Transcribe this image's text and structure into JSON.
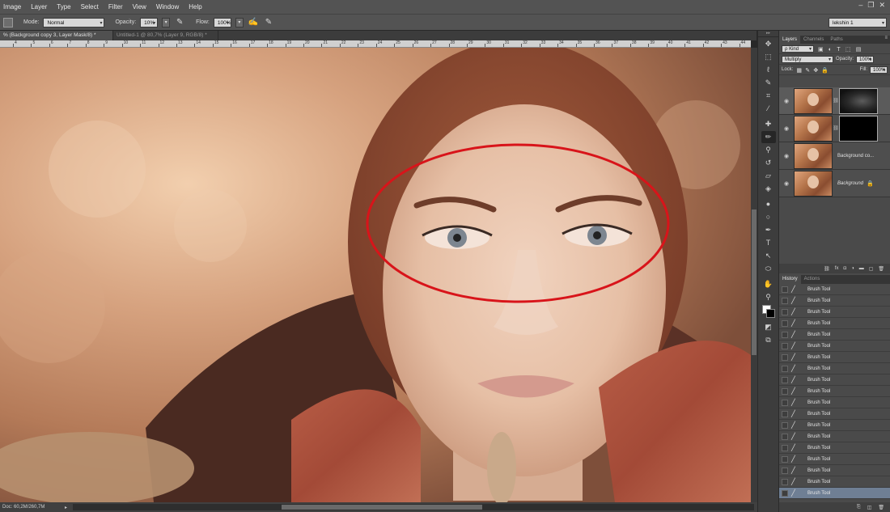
{
  "menubar": {
    "items": [
      "Image",
      "Layer",
      "Type",
      "Select",
      "Filter",
      "View",
      "Window",
      "Help"
    ],
    "window_controls": [
      "–",
      "❐",
      "✕"
    ]
  },
  "options": {
    "mode_label": "Mode:",
    "mode_value": "Normal",
    "opacity_label": "Opacity:",
    "opacity_value": "10%",
    "flow_label": "Flow:",
    "flow_value": "100%",
    "workspace_value": "lekshin 1"
  },
  "doc_tabs": [
    {
      "label": "% (Background copy 3, Layer Mask/8) *",
      "active": true
    },
    {
      "label": "Untitled-1 @ 80,7% (Layer 9, RGB/8) *",
      "active": false
    }
  ],
  "ruler": {
    "ticks": [
      "4",
      "5",
      "6",
      "7",
      "8",
      "9",
      "10",
      "11",
      "12",
      "13",
      "14",
      "15",
      "16",
      "17",
      "18",
      "19",
      "20",
      "21",
      "22",
      "23",
      "24",
      "25",
      "26",
      "27",
      "28",
      "29",
      "30",
      "31",
      "32",
      "33",
      "34",
      "35",
      "36",
      "37",
      "38",
      "39",
      "40",
      "41",
      "42",
      "43",
      "44"
    ]
  },
  "status": {
    "doc": "Doc: 60,2M/260,7M",
    "arrow": "▸"
  },
  "tools": {
    "icons": [
      "move-icon",
      "marquee-icon",
      "lasso-icon",
      "quick-select-icon",
      "crop-icon",
      "eyedropper-icon",
      "healing-icon",
      "brush-icon",
      "clone-stamp-icon",
      "history-brush-icon",
      "eraser-icon",
      "paint-bucket-icon",
      "blur-icon",
      "dodge-icon",
      "pen-icon",
      "type-icon",
      "path-select-icon",
      "ellipse-icon",
      "hand-icon",
      "zoom-icon"
    ],
    "glyphs": [
      "✥",
      "⬚",
      "ℓ",
      "✎",
      "⌗",
      "⁄",
      "✚",
      "✏",
      "⚲",
      "↺",
      "▱",
      "◈",
      "●",
      "○",
      "✒",
      "T",
      "↖",
      "⬭",
      "✋",
      "⚲"
    ],
    "active_index": 7,
    "extras": [
      "◩",
      "⧉"
    ]
  },
  "panel_tabs": {
    "top": [
      {
        "label": "Layers",
        "active": true
      },
      {
        "label": "Channels",
        "active": false
      },
      {
        "label": "Paths",
        "active": false
      }
    ],
    "bottom": [
      {
        "label": "History",
        "active": true
      },
      {
        "label": "Actions",
        "active": false
      }
    ]
  },
  "layers_panel": {
    "kind_value": "ρ Kind",
    "blend_value": "Multiply",
    "opacity_label": "Opacity:",
    "opacity_value": "100%",
    "lock_label": "Lock:",
    "fill_label": "Fill:",
    "fill_value": "100%",
    "kind_icons": [
      "▣",
      "◐",
      "T",
      "⬚",
      "▤"
    ],
    "lock_icons": [
      "▦",
      "✎",
      "✥",
      "🔒"
    ],
    "layers": [
      {
        "name": "",
        "mask": "gray",
        "selected": true
      },
      {
        "name": "",
        "mask": "black",
        "selected": false
      },
      {
        "name": "Background co...",
        "mask": "",
        "selected": false
      },
      {
        "name": "Background",
        "mask": "",
        "selected": false,
        "locked": true
      }
    ],
    "footer_icons": [
      "⛓",
      "fx",
      "◘",
      "◑",
      "▬",
      "▢",
      "🗑"
    ]
  },
  "history": {
    "items": [
      "Brush Tool",
      "Brush Tool",
      "Brush Tool",
      "Brush Tool",
      "Brush Tool",
      "Brush Tool",
      "Brush Tool",
      "Brush Tool",
      "Brush Tool",
      "Brush Tool",
      "Brush Tool",
      "Brush Tool",
      "Brush Tool",
      "Brush Tool",
      "Brush Tool",
      "Brush Tool",
      "Brush Tool",
      "Brush Tool",
      "Brush Tool"
    ],
    "selected_index": 18,
    "footer_icons": [
      "⎘",
      "◫",
      "🗑"
    ]
  },
  "colors": {
    "annotation_ellipse": "#d8141a",
    "canvas_skin": "#e6bfa5",
    "canvas_bg": "#c99a7a"
  }
}
